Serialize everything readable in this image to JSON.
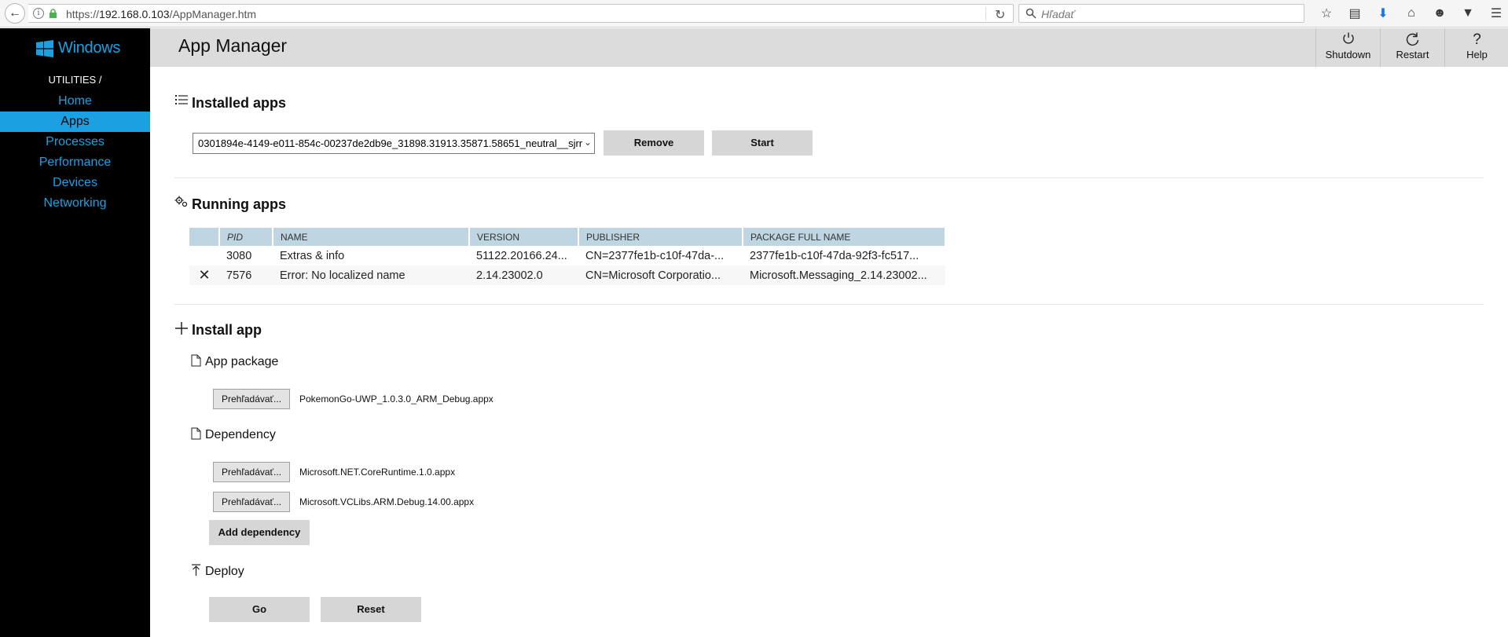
{
  "browser": {
    "url_prefix": "https://",
    "url_host": "192.168.0.103",
    "url_path": "/AppManager.htm",
    "search_placeholder": "Hľadať"
  },
  "sidebar": {
    "logo": "Windows",
    "heading": "UTILITIES /",
    "items": [
      {
        "label": "Home"
      },
      {
        "label": "Apps",
        "active": true
      },
      {
        "label": "Processes"
      },
      {
        "label": "Performance"
      },
      {
        "label": "Devices"
      },
      {
        "label": "Networking"
      }
    ]
  },
  "header": {
    "title": "App Manager",
    "buttons": [
      {
        "label": "Shutdown",
        "icon": "power-icon"
      },
      {
        "label": "Restart",
        "icon": "restart-icon"
      },
      {
        "label": "Help",
        "icon": "help-icon"
      }
    ]
  },
  "installed_apps": {
    "title": "Installed apps",
    "selected": "0301894e-4149-e011-854c-00237de2db9e_31898.31913.35871.58651_neutral__sjrr",
    "remove_label": "Remove",
    "start_label": "Start"
  },
  "running_apps": {
    "title": "Running apps",
    "columns": [
      "PID",
      "NAME",
      "VERSION",
      "PUBLISHER",
      "PACKAGE FULL NAME"
    ],
    "rows": [
      {
        "pid": "3080",
        "name": "Extras & info",
        "version": "51122.20166.24...",
        "publisher": "CN=2377fe1b-c10f-47da-...",
        "package": "2377fe1b-c10f-47da-92f3-fc517...",
        "kill": false
      },
      {
        "pid": "7576",
        "name": "Error: No localized name",
        "version": "2.14.23002.0",
        "publisher": "CN=Microsoft Corporatio...",
        "package": "Microsoft.Messaging_2.14.23002...",
        "kill": true
      }
    ]
  },
  "install_app": {
    "title": "Install app",
    "app_package_label": "App package",
    "browse_label": "Prehľadávať...",
    "app_package_file": "PokemonGo-UWP_1.0.3.0_ARM_Debug.appx",
    "dependency_label": "Dependency",
    "dependency_files": [
      "Microsoft.NET.CoreRuntime.1.0.appx",
      "Microsoft.VCLibs.ARM.Debug.14.00.appx"
    ],
    "add_dependency_label": "Add dependency",
    "deploy_label": "Deploy",
    "go_label": "Go",
    "reset_label": "Reset"
  },
  "colors": {
    "accent": "#1ba1e2",
    "sidebar_bg": "#000000",
    "header_bg": "#dcdcdc",
    "table_header_bg": "#bfd6e2"
  }
}
